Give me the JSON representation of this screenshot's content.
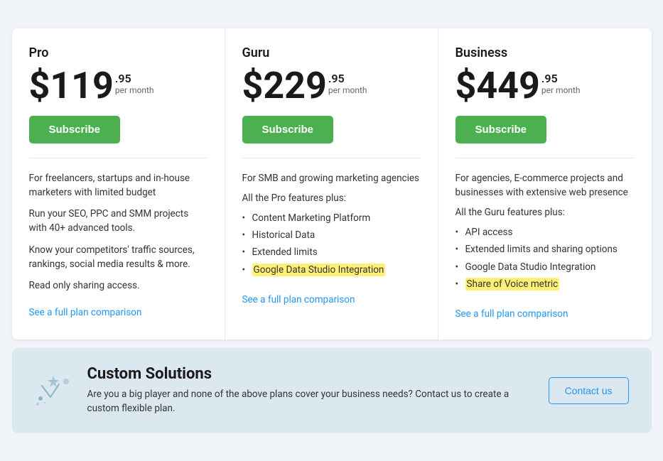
{
  "plans": [
    {
      "id": "pro",
      "name": "Pro",
      "price_main": "$119",
      "price_cents": ".95",
      "price_period": "per month",
      "subscribe_label": "Subscribe",
      "descriptions": [
        "For freelancers, startups and in-house marketers with limited budget",
        "Run your SEO, PPC and SMM projects with 40+ advanced tools.",
        "Know your competitors' traffic sources, rankings, social media results & more.",
        "Read only sharing access."
      ],
      "features_intro": null,
      "features": [],
      "comparison_link": "See a full plan comparison",
      "highlighted_feature": null
    },
    {
      "id": "guru",
      "name": "Guru",
      "price_main": "$229",
      "price_cents": ".95",
      "price_period": "per month",
      "subscribe_label": "Subscribe",
      "descriptions": [
        "For SMB and growing marketing agencies"
      ],
      "features_intro": "All the Pro features plus:",
      "features": [
        {
          "text": "Content Marketing Platform",
          "highlighted": false
        },
        {
          "text": "Historical Data",
          "highlighted": false
        },
        {
          "text": "Extended limits",
          "highlighted": false
        },
        {
          "text": "Google Data Studio Integration",
          "highlighted": true
        }
      ],
      "comparison_link": "See a full plan comparison",
      "highlighted_feature": "Google Data Studio Integration"
    },
    {
      "id": "business",
      "name": "Business",
      "price_main": "$449",
      "price_cents": ".95",
      "price_period": "per month",
      "subscribe_label": "Subscribe",
      "descriptions": [
        "For agencies, E-commerce projects and businesses with extensive web presence"
      ],
      "features_intro": "All the Guru features plus:",
      "features": [
        {
          "text": "API access",
          "highlighted": false
        },
        {
          "text": "Extended limits and sharing options",
          "highlighted": false
        },
        {
          "text": "Google Data Studio Integration",
          "highlighted": false
        },
        {
          "text": "Share of Voice metric",
          "highlighted": true
        }
      ],
      "comparison_link": "See a full plan comparison",
      "highlighted_feature": "Share of Voice metric"
    }
  ],
  "custom_solutions": {
    "title": "Custom Solutions",
    "description": "Are you a big player and none of the above plans cover your business needs? Contact us to create a custom flexible plan.",
    "contact_label": "Contact us"
  }
}
